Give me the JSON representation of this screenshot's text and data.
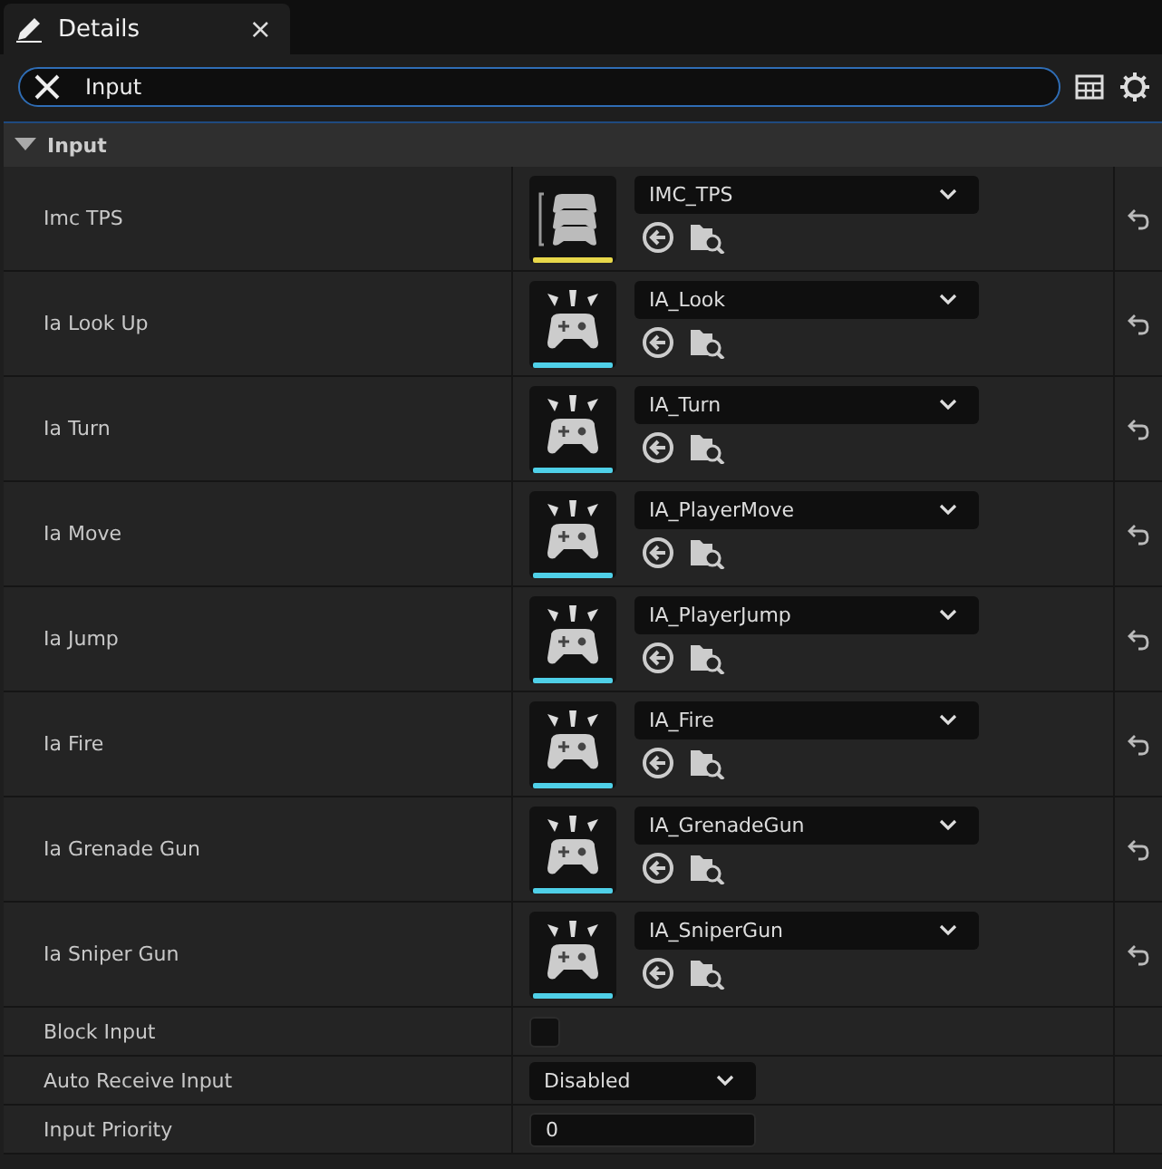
{
  "tab": {
    "title": "Details",
    "close": "×"
  },
  "search": {
    "value": "Input"
  },
  "section": {
    "title": "Input",
    "expanded": true
  },
  "rows": [
    {
      "kind": "asset",
      "label": "Imc TPS",
      "value": "IMC_TPS",
      "thumbnail": {
        "kind": "context",
        "color": "#e8d84a"
      }
    },
    {
      "kind": "asset",
      "label": "Ia Look Up",
      "value": "IA_Look",
      "thumbnail": {
        "kind": "action",
        "color": "#4fd0e8"
      }
    },
    {
      "kind": "asset",
      "label": "Ia Turn",
      "value": "IA_Turn",
      "thumbnail": {
        "kind": "action",
        "color": "#4fd0e8"
      }
    },
    {
      "kind": "asset",
      "label": "Ia Move",
      "value": "IA_PlayerMove",
      "thumbnail": {
        "kind": "action",
        "color": "#4fd0e8"
      }
    },
    {
      "kind": "asset",
      "label": "Ia Jump",
      "value": "IA_PlayerJump",
      "thumbnail": {
        "kind": "action",
        "color": "#4fd0e8"
      }
    },
    {
      "kind": "asset",
      "label": "Ia Fire",
      "value": "IA_Fire",
      "thumbnail": {
        "kind": "action",
        "color": "#4fd0e8"
      }
    },
    {
      "kind": "asset",
      "label": "Ia Grenade Gun",
      "value": "IA_GrenadeGun",
      "thumbnail": {
        "kind": "action",
        "color": "#4fd0e8"
      }
    },
    {
      "kind": "asset",
      "label": "Ia Sniper Gun",
      "value": "IA_SniperGun",
      "thumbnail": {
        "kind": "action",
        "color": "#4fd0e8"
      }
    },
    {
      "kind": "checkbox",
      "label": "Block Input",
      "checked": false
    },
    {
      "kind": "dropdown",
      "label": "Auto Receive Input",
      "value": "Disabled"
    },
    {
      "kind": "number",
      "label": "Input Priority",
      "value": "0"
    }
  ]
}
